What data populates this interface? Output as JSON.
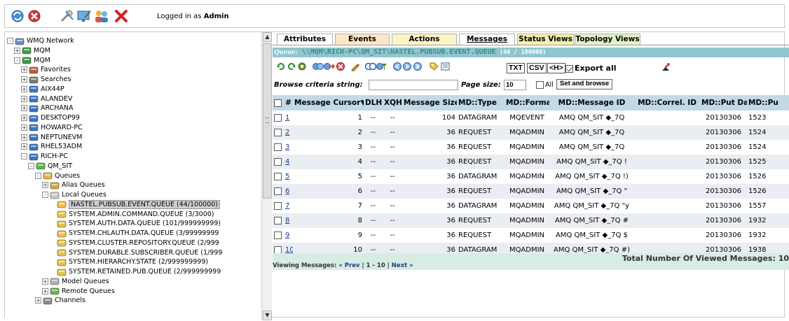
{
  "topbar": {
    "icons": [
      "refresh-icon",
      "stop-icon",
      "tools-icon",
      "monitor-icon",
      "users-icon",
      "close-icon"
    ],
    "logged_prefix": "Logged in as ",
    "logged_user": "Admin"
  },
  "tree": {
    "nodes": [
      {
        "label": "WMQ Network",
        "exp": "-",
        "icon": "network-icon"
      },
      {
        "label": "MQM",
        "exp": "+",
        "icon": "mqm-icon"
      },
      {
        "label": "MQM",
        "exp": "-",
        "icon": "mqm-icon"
      },
      {
        "label": "Favorites",
        "exp": "+",
        "icon": "folder-icon"
      },
      {
        "label": "Searches",
        "exp": "+",
        "icon": "binoculars-icon"
      },
      {
        "label": "AIX44P",
        "exp": "+",
        "icon": "server-icon"
      },
      {
        "label": "ALANDEV",
        "exp": "+",
        "icon": "server-icon"
      },
      {
        "label": "ARCHANA",
        "exp": "+",
        "icon": "server-icon"
      },
      {
        "label": "DESKTOP99",
        "exp": "+",
        "icon": "server-icon"
      },
      {
        "label": "HOWARD-PC",
        "exp": "+",
        "icon": "server-icon"
      },
      {
        "label": "NEPTUNEVM",
        "exp": "+",
        "icon": "server-icon"
      },
      {
        "label": "RHEL53ADM",
        "exp": "+",
        "icon": "server-icon"
      },
      {
        "label": "RICH-PC",
        "exp": "-",
        "icon": "server-icon"
      },
      {
        "label": "QM_SIT",
        "exp": "-",
        "icon": "qmgr-icon"
      },
      {
        "label": "Queues",
        "exp": "-",
        "icon": "queues-icon"
      },
      {
        "label": "Alias Queues",
        "exp": "+",
        "icon": "alias-queue-icon"
      },
      {
        "label": "Local Queues",
        "exp": "-",
        "icon": "local-queue-icon"
      },
      {
        "label": "NASTEL.PUBSUB.EVENT.QUEUE (44/100000)",
        "exp": "",
        "icon": "queue-icon"
      },
      {
        "label": "SYSTEM.ADMIN.COMMAND.QUEUE (3/3000)",
        "exp": "",
        "icon": "queue-icon"
      },
      {
        "label": "SYSTEM.AUTH.DATA.QUEUE (101/999999999)",
        "exp": "",
        "icon": "queue-icon"
      },
      {
        "label": "SYSTEM.CHLAUTH.DATA.QUEUE (3/99999999",
        "exp": "",
        "icon": "queue-icon"
      },
      {
        "label": "SYSTEM.CLUSTER.REPOSITORY.QUEUE (2/999",
        "exp": "",
        "icon": "queue-icon"
      },
      {
        "label": "SYSTEM.DURABLE.SUBSCRIBER.QUEUE (1/999",
        "exp": "",
        "icon": "queue-icon"
      },
      {
        "label": "SYSTEM.HIERARCHY.STATE (2/999999999)",
        "exp": "",
        "icon": "queue-icon"
      },
      {
        "label": "SYSTEM.RETAINED.PUB.QUEUE (2/999999999",
        "exp": "",
        "icon": "queue-icon"
      },
      {
        "label": "Model Queues",
        "exp": "+",
        "icon": "model-queue-icon"
      },
      {
        "label": "Remote Queues",
        "exp": "+",
        "icon": "remote-queue-icon"
      },
      {
        "label": "Channels",
        "exp": "+",
        "icon": "channels-icon"
      }
    ]
  },
  "tabs": [
    {
      "label": "Attributes",
      "color": "#ffffff"
    },
    {
      "label": "Events",
      "color": "#fde6c7"
    },
    {
      "label": "Actions",
      "color": "#fbf4c6"
    },
    {
      "label": "Messages",
      "color": "#ffffff"
    },
    {
      "label": "Status Views",
      "color": "#f2f0b0"
    },
    {
      "label": "Topology Views",
      "color": "#dff2c6"
    }
  ],
  "queue": {
    "label": "Queue:",
    "path": "\\\\MQM\\RICH-PC\\QM_SIT\\NASTEL.PUBSUB.EVENT.QUEUE",
    "count": " (44 / 100000)"
  },
  "toolbar": {
    "txt": "TXT",
    "csv": "CSV",
    "hdr": "<H>",
    "export_all": "Export all"
  },
  "browse": {
    "criteria_label": "Browse criteria string:",
    "criteria_value": "",
    "page_size_label": "Page size:",
    "page_size_value": "10",
    "all_label": "All",
    "set_button": "Set and browse"
  },
  "table": {
    "headers": [
      "",
      "#",
      "Message Cursor▼",
      "DLH",
      "XQH",
      "Message Size",
      "MD::Type",
      "MD::Format",
      "MD::Message ID",
      "MD::Correl. ID",
      "MD::Put Date",
      "MD::Pu"
    ],
    "rows": [
      [
        "1",
        "1",
        "--",
        "--",
        "104",
        "DATAGRAM",
        "MQEVENT",
        "AMQ QM_SIT ◆_7Q",
        "",
        "20130306",
        "1523"
      ],
      [
        "2",
        "2",
        "--",
        "--",
        "36",
        "REQUEST",
        "MQADMIN",
        "AMQ QM_SIT ◆_7Q",
        "",
        "20130306",
        "1524"
      ],
      [
        "3",
        "3",
        "--",
        "--",
        "36",
        "REQUEST",
        "MQADMIN",
        "AMQ QM_SIT ◆_7Q",
        "",
        "20130306",
        "1524"
      ],
      [
        "4",
        "4",
        "--",
        "--",
        "36",
        "REQUEST",
        "MQADMIN",
        "AMQ QM_SIT ◆_7Q !",
        "",
        "20130306",
        "1525"
      ],
      [
        "5",
        "5",
        "--",
        "--",
        "36",
        "DATAGRAM",
        "MQADMIN",
        "AMQ QM_SIT ◆_7Q !)",
        "",
        "20130306",
        "1526"
      ],
      [
        "6",
        "6",
        "--",
        "--",
        "36",
        "REQUEST",
        "MQADMIN",
        "AMQ QM_SIT ◆_7Q \"",
        "",
        "20130306",
        "1526"
      ],
      [
        "7",
        "7",
        "--",
        "--",
        "36",
        "DATAGRAM",
        "MQADMIN",
        "AMQ QM_SIT ◆_7Q \"y",
        "",
        "20130306",
        "1557"
      ],
      [
        "8",
        "8",
        "--",
        "--",
        "36",
        "REQUEST",
        "MQADMIN",
        "AMQ QM_SIT ◆_7Q #",
        "",
        "20130306",
        "1932"
      ],
      [
        "9",
        "9",
        "--",
        "--",
        "36",
        "REQUEST",
        "MQADMIN",
        "AMQ QM_SIT ◆_7Q $",
        "",
        "20130306",
        "1932"
      ],
      [
        "10",
        "10",
        "--",
        "--",
        "36",
        "DATAGRAM",
        "MQADMIN",
        "AMQ QM_SIT ◆_7Q #)",
        "",
        "20130306",
        "1938"
      ]
    ]
  },
  "footer": {
    "total": "Total Number Of Viewed Messages: 10",
    "viewing_label": "Viewing Messages:",
    "prev": "« Prev",
    "range": " | 1 - 10 | ",
    "next": "Next »"
  }
}
